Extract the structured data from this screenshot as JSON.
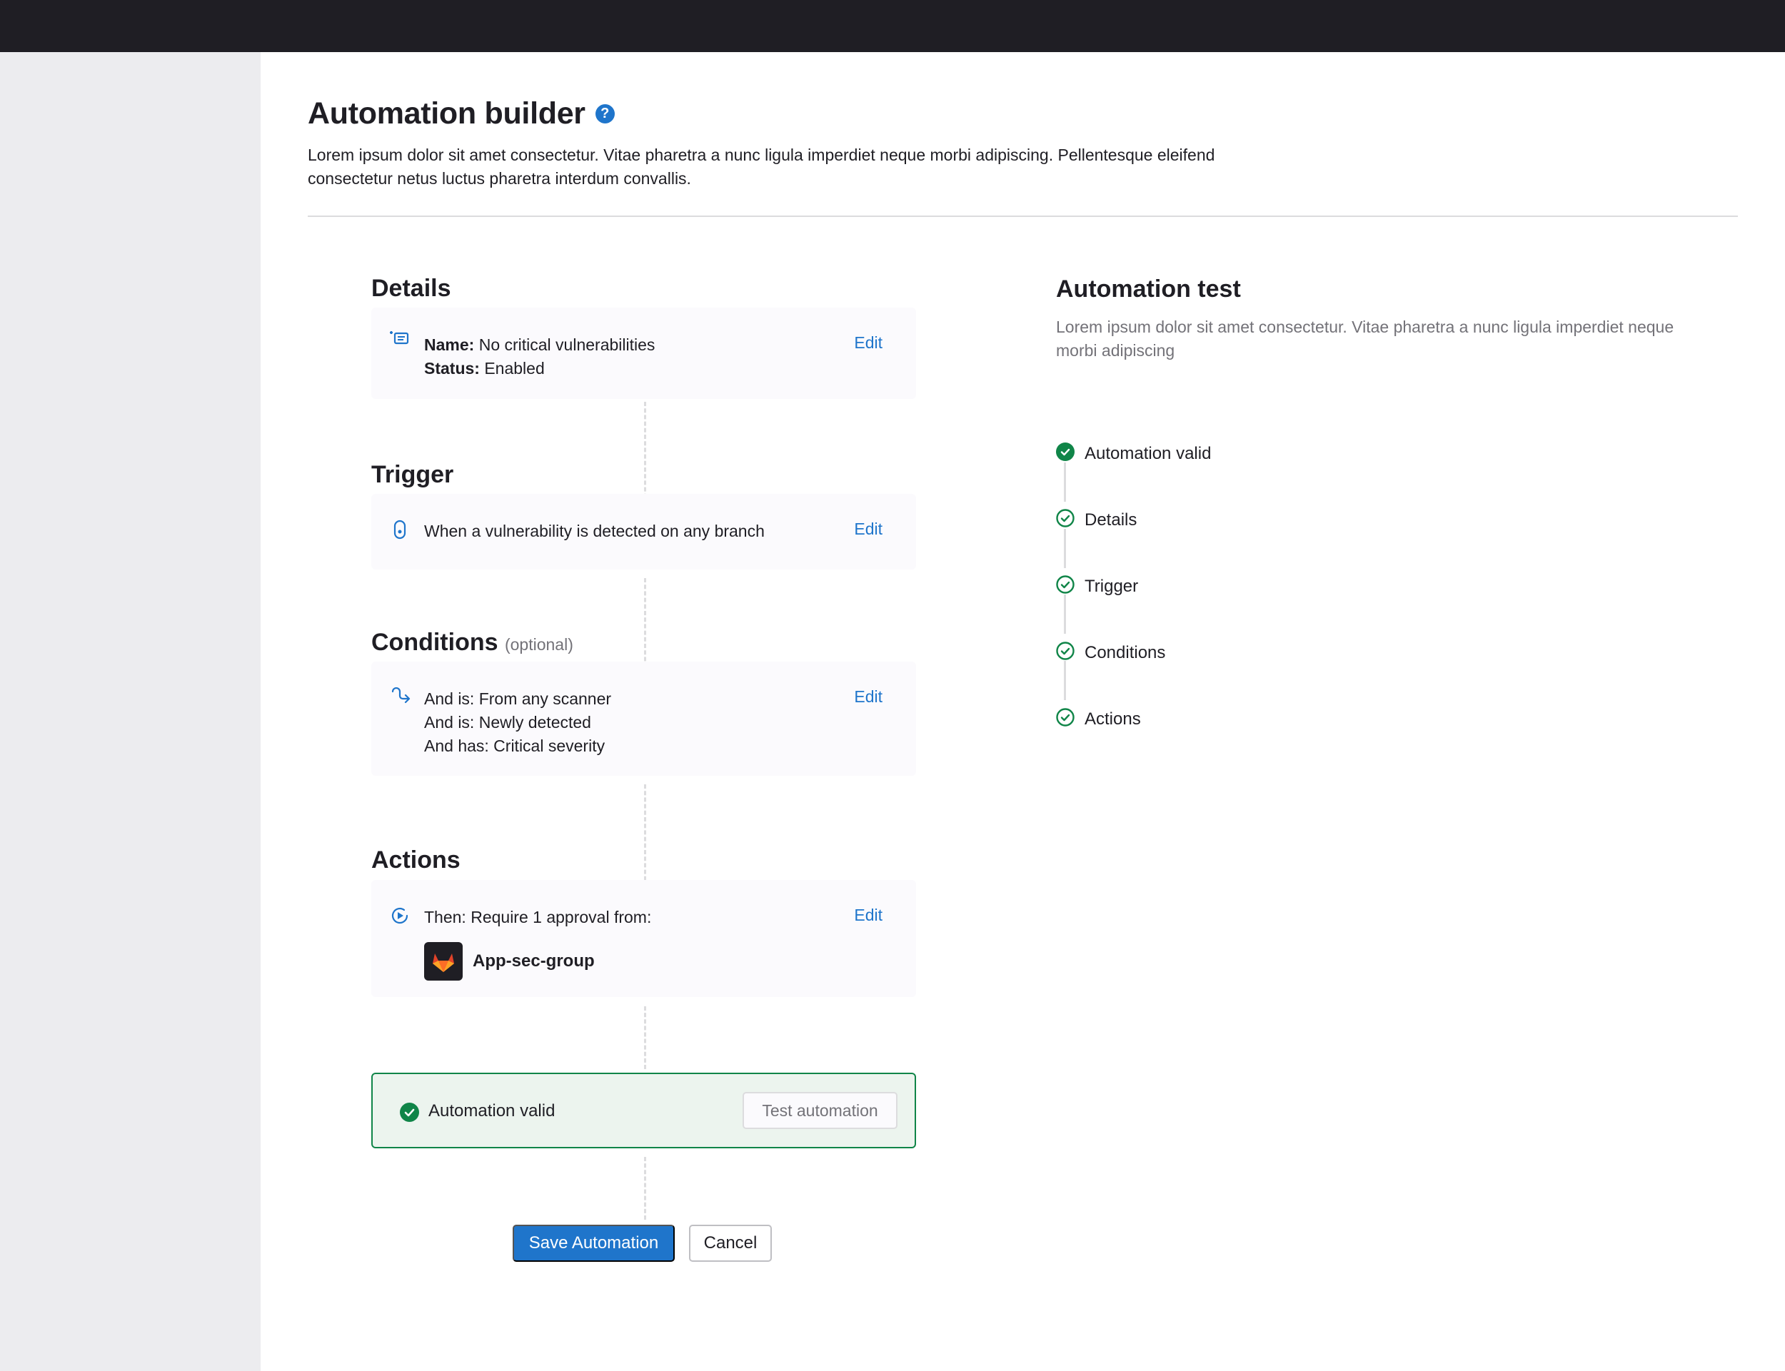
{
  "page": {
    "title": "Automation builder",
    "description": "Lorem ipsum dolor sit amet consectetur. Vitae pharetra a nunc ligula imperdiet neque morbi adipiscing. Pellentesque eleifend consectetur netus luctus pharetra interdum convallis."
  },
  "details": {
    "title": "Details",
    "name_label": "Name:",
    "name_value": "No critical vulnerabilities",
    "status_label": "Status:",
    "status_value": "Enabled",
    "edit": "Edit"
  },
  "trigger": {
    "title": "Trigger",
    "text": "When a vulnerability is detected on any branch",
    "edit": "Edit"
  },
  "conditions": {
    "title": "Conditions",
    "optional": "(optional)",
    "lines": [
      "And is: From any scanner",
      "And is: Newly detected",
      "And has: Critical severity"
    ],
    "edit": "Edit"
  },
  "actions": {
    "title": "Actions",
    "text": "Then: Require 1 approval from:",
    "group_name": "App-sec-group",
    "edit": "Edit"
  },
  "validation": {
    "label": "Automation valid",
    "test_button": "Test automation"
  },
  "buttons": {
    "save": "Save Automation",
    "cancel": "Cancel"
  },
  "test_panel": {
    "title": "Automation test",
    "description": "Lorem ipsum dolor sit amet consectetur. Vitae pharetra a nunc ligula imperdiet neque morbi adipiscing",
    "steps": [
      "Automation valid",
      "Details",
      "Trigger",
      "Conditions",
      "Actions"
    ]
  },
  "colors": {
    "accent": "#1f75cb",
    "success": "#108548",
    "topbar": "#1f1e24",
    "sidebar": "#ececef"
  }
}
